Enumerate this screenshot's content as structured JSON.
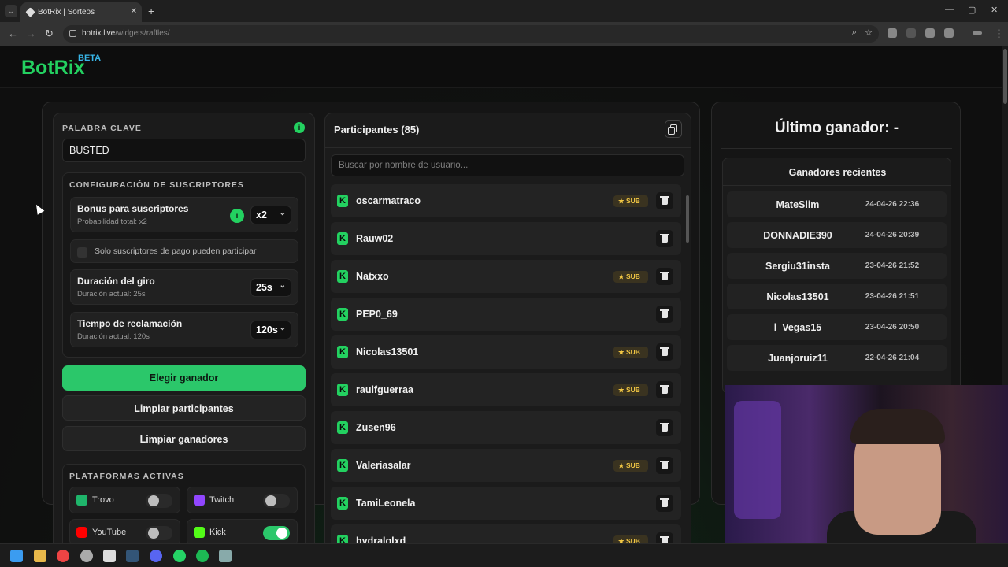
{
  "browser": {
    "tab_title": "BotRix | Sorteos",
    "url_host": "botrix.live",
    "url_path": "/widgets/raffles/"
  },
  "brand": {
    "name": "BotRix",
    "badge": "BETA",
    "accent": "#23d160",
    "badge_color": "#38b6e8"
  },
  "keyword": {
    "label": "PALABRA CLAVE",
    "info": "i",
    "value": "BUSTED"
  },
  "subs_config": {
    "title": "CONFIGURACIÓN DE SUSCRIPTORES",
    "bonus": {
      "title": "Bonus para suscriptores",
      "subtitle": "Probabilidad total: x2",
      "info": "i",
      "value": "x2"
    },
    "paid_only": {
      "label": "Solo suscriptores de pago pueden participar"
    },
    "spin": {
      "title": "Duración del giro",
      "subtitle": "Duración actual: 25s",
      "value": "25s"
    },
    "claim": {
      "title": "Tiempo de reclamación",
      "subtitle": "Duración actual: 120s",
      "value": "120s"
    }
  },
  "buttons": {
    "pick": "Elegir ganador",
    "clear_participants": "Limpiar participantes",
    "clear_winners": "Limpiar ganadores"
  },
  "platforms": {
    "title": "PLATAFORMAS ACTIVAS",
    "items": [
      {
        "name": "Trovo",
        "on": false,
        "color": "#1fb56b"
      },
      {
        "name": "Twitch",
        "on": false,
        "color": "#9146ff"
      },
      {
        "name": "YouTube",
        "on": false,
        "color": "#ff0000"
      },
      {
        "name": "Kick",
        "on": true,
        "color": "#53fc18"
      }
    ]
  },
  "participants": {
    "title": "Participantes (85)",
    "search_placeholder": "Buscar por nombre de usuario...",
    "sub_label": "★ SUB",
    "k": "K",
    "items": [
      {
        "name": "oscarmatraco",
        "sub": true
      },
      {
        "name": "Rauw02",
        "sub": false
      },
      {
        "name": "Natxxo",
        "sub": true
      },
      {
        "name": "PEP0_69",
        "sub": false
      },
      {
        "name": "Nicolas13501",
        "sub": true
      },
      {
        "name": "raulfguerraa",
        "sub": true
      },
      {
        "name": "Zusen96",
        "sub": false
      },
      {
        "name": "Valeriasalar",
        "sub": true
      },
      {
        "name": "TamiLeonela",
        "sub": false
      },
      {
        "name": "hydralolxd",
        "sub": true
      }
    ]
  },
  "last_winner": {
    "title": "Último ganador: -"
  },
  "recent_winners": {
    "title": "Ganadores recientes",
    "items": [
      {
        "name": "MateSlim",
        "date": "24-04-26 22:36"
      },
      {
        "name": "DONNADIE390",
        "date": "24-04-26 20:39"
      },
      {
        "name": "Sergiu31insta",
        "date": "23-04-26 21:52"
      },
      {
        "name": "Nicolas13501",
        "date": "23-04-26 21:51"
      },
      {
        "name": "l_Vegas15",
        "date": "23-04-26 20:50"
      },
      {
        "name": "Juanjoruiz11",
        "date": "22-04-26 21:04"
      }
    ]
  }
}
